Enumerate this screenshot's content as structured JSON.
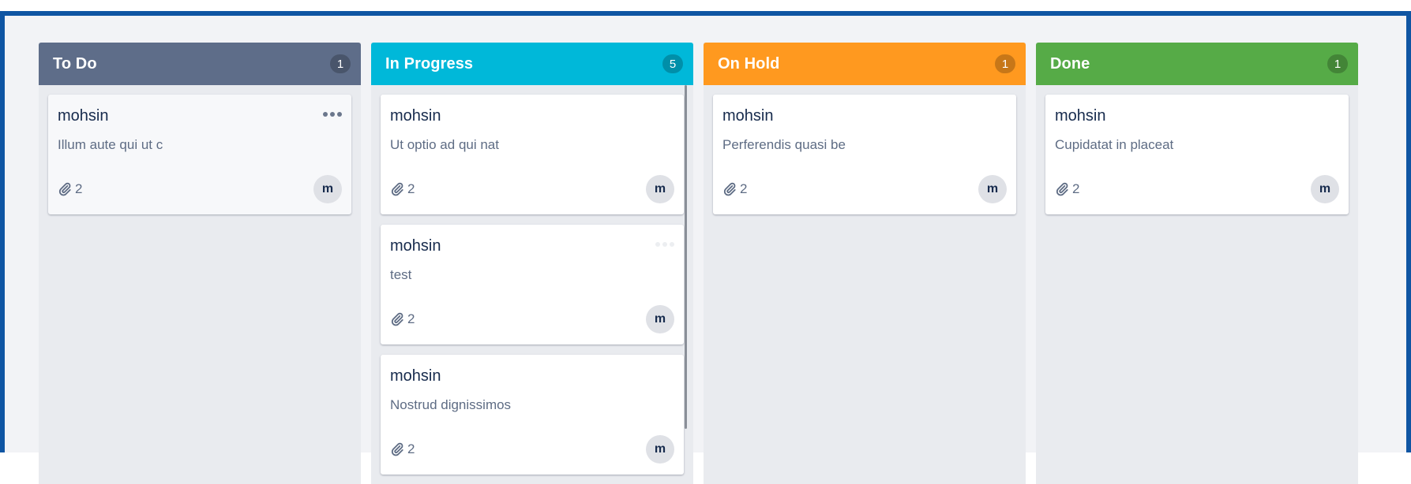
{
  "colors": {
    "todo": "#5e6d89",
    "in_progress": "#00b8d9",
    "on_hold": "#ff991f",
    "done": "#56ab47",
    "frame": "#0f55a3"
  },
  "columns": [
    {
      "title": "To Do",
      "count": "1",
      "cards": [
        {
          "title": "mohsin",
          "desc": "Illum aute qui ut c",
          "attachments": "2",
          "avatar": "m",
          "menu_icon": "more-icon"
        }
      ]
    },
    {
      "title": "In Progress",
      "count": "5",
      "cards": [
        {
          "title": "mohsin",
          "desc": "Ut optio ad qui nat",
          "attachments": "2",
          "avatar": "m"
        },
        {
          "title": "mohsin",
          "desc": "test",
          "attachments": "2",
          "avatar": "m"
        },
        {
          "title": "mohsin",
          "desc": "Nostrud dignissimos",
          "attachments": "2",
          "avatar": "m"
        }
      ]
    },
    {
      "title": "On Hold",
      "count": "1",
      "cards": [
        {
          "title": "mohsin",
          "desc": "Perferendis quasi be",
          "attachments": "2",
          "avatar": "m"
        }
      ]
    },
    {
      "title": "Done",
      "count": "1",
      "cards": [
        {
          "title": "mohsin",
          "desc": "Cupidatat in placeat",
          "attachments": "2",
          "avatar": "m"
        }
      ]
    }
  ]
}
